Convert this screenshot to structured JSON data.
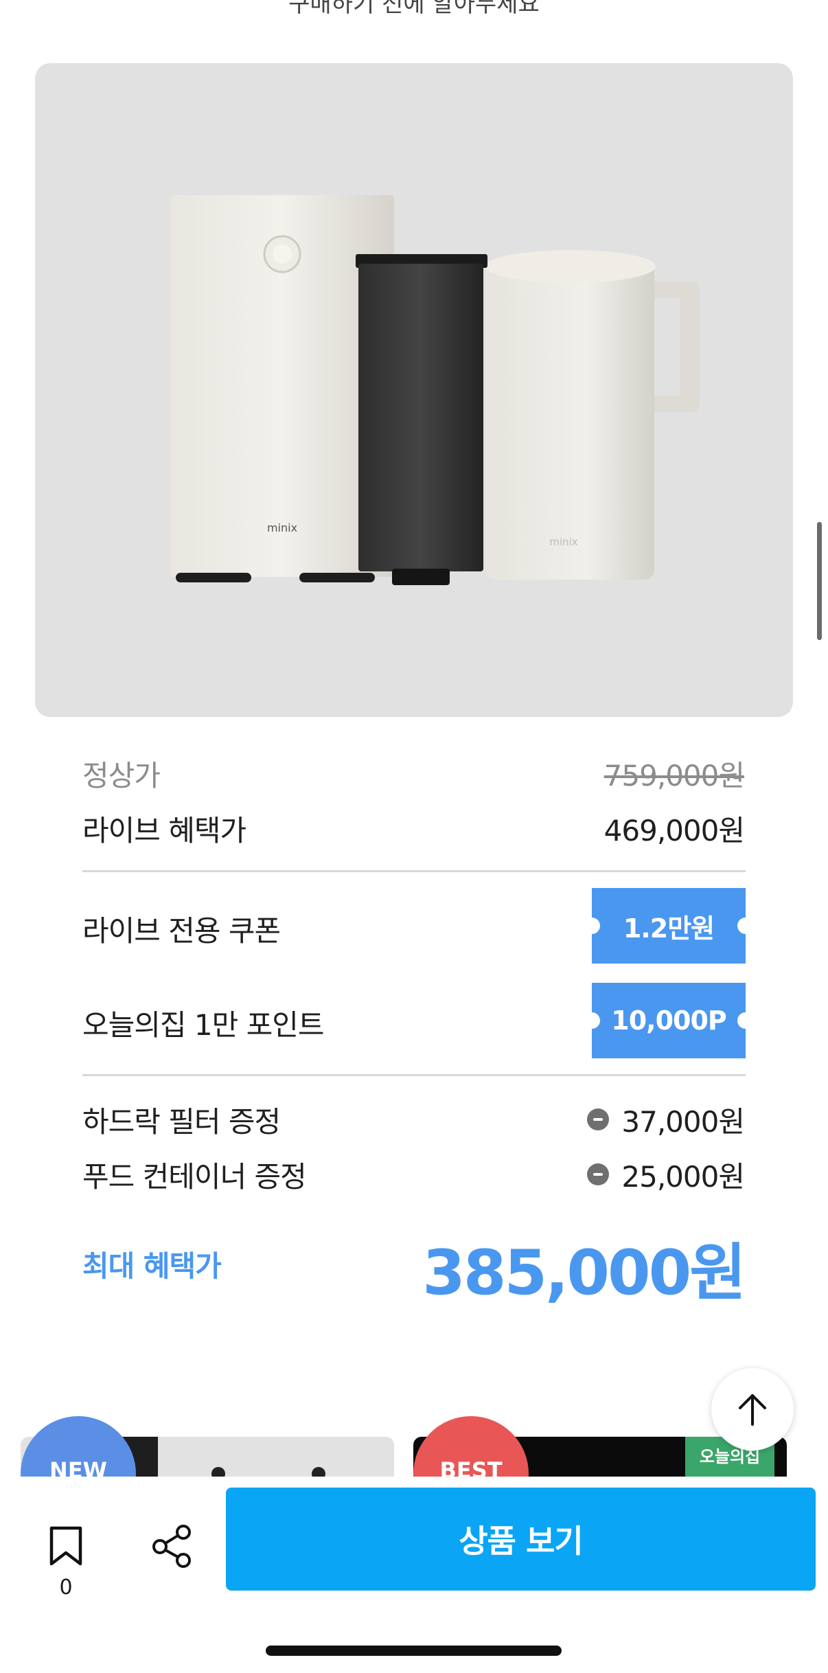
{
  "top_partial_text": "구매하기 전에 알아두세요",
  "product": {
    "brand_mark_left": "minix",
    "brand_mark_right": "minix",
    "image_name": "water purifier set"
  },
  "pricing": {
    "regular_label": "정상가",
    "regular_value": "759,000원",
    "live_label": "라이브 혜택가",
    "live_value": "469,000원"
  },
  "coupons": [
    {
      "label": "라이브 전용 쿠폰",
      "tag": "1.2만원"
    },
    {
      "label": "오늘의집 1만 포인트",
      "tag": "10,000P"
    }
  ],
  "gifts": [
    {
      "label": "하드락 필터 증정",
      "value": "37,000원"
    },
    {
      "label": "푸드 컨테이너 증정",
      "value": "25,000원"
    }
  ],
  "max_benefit": {
    "label": "최대 혜택가",
    "value": "385,000원"
  },
  "peek_cards": {
    "new_badge": "NEW",
    "best_badge": "BEST",
    "ohouse_tag": "오늘의집"
  },
  "bottom_bar": {
    "bookmark_count": "0",
    "view_button": "상품 보기"
  },
  "colors": {
    "accent_blue": "#4a97f0",
    "cta_blue": "#0aa5f5",
    "new_badge": "#5b8fe6",
    "best_badge": "#e85656",
    "ohouse_green": "#3aa66a"
  }
}
